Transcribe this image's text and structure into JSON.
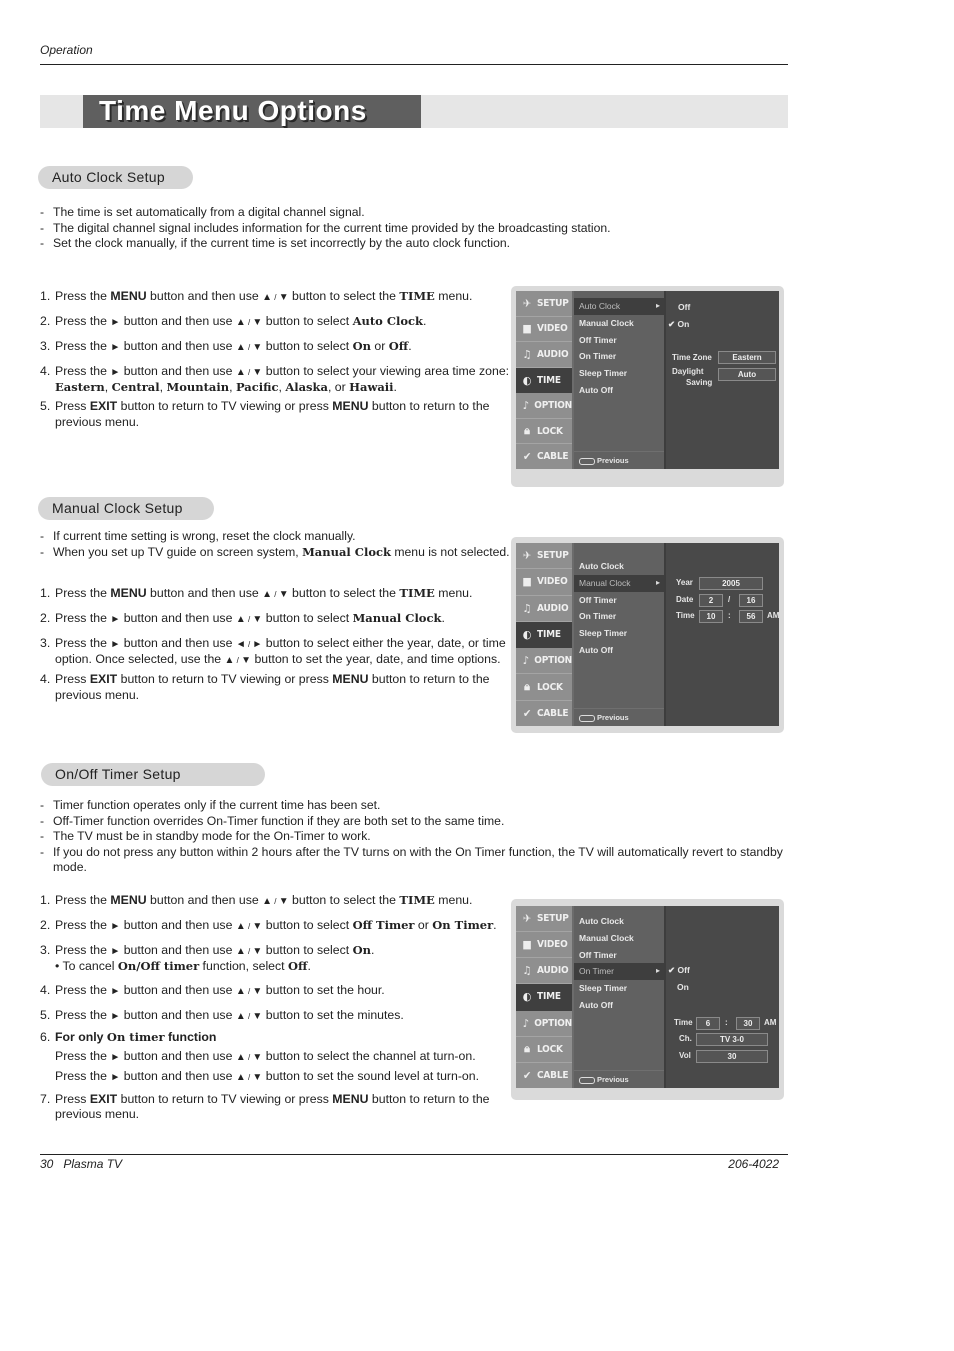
{
  "header": {
    "section": "Operation"
  },
  "title": "Time Menu Options",
  "sections": {
    "auto": {
      "heading": "Auto Clock Setup",
      "bullets": [
        "The time is set automatically from a digital channel signal.",
        "The digital channel signal includes information for the current time provided by the broadcasting station.",
        "Set the clock manually, if the current time is set incorrectly by the auto clock function."
      ],
      "steps": {
        "s1": {
          "n": "1.",
          "a": "Press the ",
          "b": "MENU",
          "c": " button and then use ",
          "up": "▲",
          "sl": " / ",
          "dn": "▼",
          "d": "  button to select the ",
          "e": "TIME",
          "f": " menu."
        },
        "s2": {
          "n": "2.",
          "a": "Press the ",
          "r": "►",
          "c": "  button and then use ",
          "up": "▲",
          "sl": " / ",
          "dn": "▼",
          "d": " button to select ",
          "e": "Auto Clock",
          "f": "."
        },
        "s3": {
          "n": "3.",
          "a": "Press the ",
          "r": "►",
          "c": "  button and then use ",
          "up": "▲",
          "sl": " / ",
          "dn": "▼",
          "d": " button to select ",
          "e": "On",
          "or": " or ",
          "g": "Off",
          "f": "."
        },
        "s4": {
          "n": "4.",
          "a": "Press the ",
          "r": "►",
          "c": "  button and then use ",
          "up": "▲",
          "sl": " / ",
          "dn": "▼",
          "d": " button to select your viewing area time zone: ",
          "z1": "Eastern",
          "z2": "Central",
          "z3": "Mountain",
          "z4": "Pacific",
          "z5": "Alaska",
          "or": ", or ",
          "z6": "Hawaii",
          "comma": ", ",
          "f": "."
        },
        "s5": {
          "n": "5.",
          "a": "Press ",
          "b": "EXIT",
          "c": " button to return to TV viewing or press ",
          "e": "MENU",
          "f": " button to return to the previous menu."
        }
      },
      "osd": {
        "sidebar": [
          "SETUP",
          "VIDEO",
          "AUDIO",
          "TIME",
          "OPTION",
          "LOCK",
          "CABLE"
        ],
        "items": [
          "Auto Clock",
          "Manual Clock",
          "Off Timer",
          "On Timer",
          "Sleep Timer",
          "Auto Off"
        ],
        "selected_item": "Auto Clock",
        "previous": "Previous",
        "options": [
          "Off",
          "On"
        ],
        "checked_option": "On",
        "check": "✔",
        "timezone_label": "Time Zone",
        "timezone_value": "Eastern",
        "daylight_label_1": "Daylight",
        "daylight_label_2": "Saving",
        "daylight_value": "Auto"
      }
    },
    "manual": {
      "heading": "Manual Clock Setup",
      "bullets": [
        "If current time setting is wrong, reset the clock manually.",
        "When you set up TV  guide on screen system, ",
        "Manual Clock",
        " menu is not selected."
      ],
      "steps": {
        "s1": {
          "n": "1.",
          "a": "Press the ",
          "b": "MENU",
          "c": " button and then use ",
          "up": "▲",
          "sl": " / ",
          "dn": "▼",
          "d": "  button to select the ",
          "e": "TIME",
          "f": " menu."
        },
        "s2": {
          "n": "2.",
          "a": "Press the ",
          "r": "►",
          "c": "  button and then use ",
          "up": "▲",
          "sl": " / ",
          "dn": "▼",
          "d": " button to select ",
          "e": "Manual Clock",
          "f": "."
        },
        "s3": {
          "n": "3.",
          "a": "Press the ",
          "r": "►",
          "c": "  button and then use ",
          "lt": "◄",
          "sl": " / ",
          "rt": "►",
          "d": " button to select either the year, date, or time option. Once selected, use the ",
          "up": "▲",
          "dn": "▼",
          "f": " button to set the year, date, and time options."
        },
        "s4": {
          "n": "4.",
          "a": "Press ",
          "b": "EXIT",
          "c": " button to return to TV viewing or press ",
          "e": "MENU",
          "f": " button to return to the previous menu."
        }
      },
      "osd": {
        "sidebar": [
          "SETUP",
          "VIDEO",
          "AUDIO",
          "TIME",
          "OPTION",
          "LOCK",
          "CABLE"
        ],
        "items": [
          "Auto Clock",
          "Manual Clock",
          "Off Timer",
          "On Timer",
          "Sleep Timer",
          "Auto Off"
        ],
        "selected_item": "Manual Clock",
        "previous": "Previous",
        "year_label": "Year",
        "year_value": "2005",
        "date_label": "Date",
        "month_value": "2",
        "date_sep": "/",
        "day_value": "16",
        "time_label": "Time",
        "hour_value": "10",
        "time_sep": ":",
        "minute_value": "56",
        "ampm": "AM"
      }
    },
    "timer": {
      "heading": "On/Off Timer Setup",
      "bullets": [
        "Timer function operates only if the current time has been set.",
        "Off-Timer function overrides On-Timer function if they are both set to the same time.",
        "The TV must be in standby mode for the On-Timer to work.",
        "If you do not press any button within 2 hours after the TV turns on with the On Timer function, the TV will automatically revert to standby mode."
      ],
      "steps": {
        "s1": {
          "n": "1.",
          "a": "Press the ",
          "b": "MENU",
          "c": " button and then use ",
          "up": "▲",
          "sl": " / ",
          "dn": "▼",
          "d": "  button to select the ",
          "e": "TIME",
          "f": " menu."
        },
        "s2": {
          "n": "2.",
          "a": "Press the ",
          "r": "►",
          "c": " button and then use ",
          "up": "▲",
          "sl": " / ",
          "dn": "▼",
          "d": " button to select ",
          "e": "Off Timer",
          "or": " or ",
          "g": "On Timer",
          "f": "."
        },
        "s3": {
          "n": "3.",
          "a": "Press the ",
          "r": "►",
          "c": "  button and then use ",
          "up": "▲",
          "sl": " / ",
          "dn": "▼",
          "d": " button to select ",
          "e": "On",
          "f": ".",
          "note_a": "• To cancel ",
          "note_b": "On/Off timer",
          "note_c": " function, select ",
          "note_d": "Off",
          "note_e": "."
        },
        "s4": {
          "n": "4.",
          "a": "Press the ",
          "r": "►",
          "c": "  button and then use ",
          "up": "▲",
          "sl": " / ",
          "dn": "▼",
          "d": " button to set the hour."
        },
        "s5": {
          "n": "5.",
          "a": "Press the ",
          "r": "►",
          "c": "  button and then use ",
          "up": "▲",
          "sl": " / ",
          "dn": "▼",
          "d": " button to set the minutes."
        },
        "s6": {
          "n": "6.",
          "a": "For only ",
          "b": "On timer",
          "c": " function",
          "l1a": "Press the ",
          "r": "►",
          "l1b": "  button and then use ",
          "up": "▲",
          "sl": " / ",
          "dn": "▼",
          "l1c": " button to select the channel at turn-on.",
          "l2c": " button to set the sound level at turn-on."
        },
        "s7": {
          "n": "7.",
          "a": "Press ",
          "b": "EXIT",
          "c": " button to return to TV viewing or press ",
          "e": "MENU",
          "f": " button to return to the previous menu."
        }
      },
      "osd": {
        "sidebar": [
          "SETUP",
          "VIDEO",
          "AUDIO",
          "TIME",
          "OPTION",
          "LOCK",
          "CABLE"
        ],
        "items": [
          "Auto Clock",
          "Manual Clock",
          "Off Timer",
          "On Timer",
          "Sleep Timer",
          "Auto Off"
        ],
        "selected_item": "On Timer",
        "previous": "Previous",
        "options": [
          "Off",
          "On"
        ],
        "checked_option": "Off",
        "check": "✔",
        "time_label": "Time",
        "hour_value": "6",
        "time_sep": ":",
        "minute_value": "30",
        "ampm": "AM",
        "ch_label": "Ch.",
        "ch_value": "TV 3-0",
        "vol_label": "Vol",
        "vol_value": "30"
      }
    }
  },
  "footer": {
    "page": "30",
    "product": "Plasma TV",
    "doc_number": "206-4022"
  }
}
